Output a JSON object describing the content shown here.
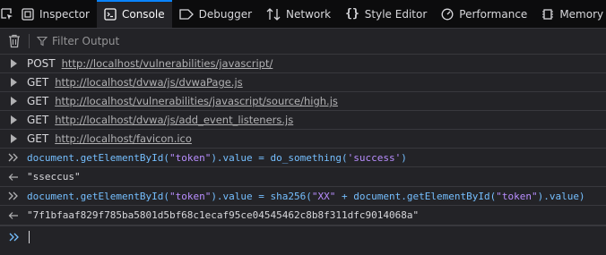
{
  "tabs": [
    {
      "label": "Inspector",
      "icon": "inspector-icon"
    },
    {
      "label": "Console",
      "icon": "console-icon",
      "selected": true
    },
    {
      "label": "Debugger",
      "icon": "debugger-icon"
    },
    {
      "label": "Network",
      "icon": "network-icon"
    },
    {
      "label": "Style Editor",
      "icon": "style-editor-icon"
    },
    {
      "label": "Performance",
      "icon": "performance-icon"
    },
    {
      "label": "Memory",
      "icon": "memory-icon"
    }
  ],
  "toolbar": {
    "filter_placeholder": "Filter Output"
  },
  "requests": [
    {
      "method": "POST",
      "url": "http://localhost/vulnerabilities/javascript/"
    },
    {
      "method": "GET",
      "url": "http://localhost/dvwa/js/dvwaPage.js"
    },
    {
      "method": "GET",
      "url": "http://localhost/vulnerabilities/javascript/source/high.js"
    },
    {
      "method": "GET",
      "url": "http://localhost/dvwa/js/add_event_listeners.js"
    },
    {
      "method": "GET",
      "url": "http://localhost/favicon.ico"
    }
  ],
  "commands": [
    {
      "input": {
        "p1": "document.getElementById(",
        "s1": "\"token\"",
        "p2": ").value = do_something(",
        "s2": "'success'",
        "p3": ")"
      },
      "result": "\"sseccus\""
    },
    {
      "input": {
        "p1": "document.getElementById(",
        "s1": "\"token\"",
        "p2": ").value = sha256(",
        "s2": "\"XX\"",
        "p3": " + document.getElementById(",
        "s3": "\"token\"",
        "p4": ").value)"
      },
      "result": "\"7f1bfaaf829f785ba5801d5bf68c1ecaf95ce04545462c8b8f311dfc9014068a\""
    }
  ],
  "colors": {
    "accent": "#0a84ff",
    "string": "#b98eff",
    "identifier": "#75bfff"
  }
}
